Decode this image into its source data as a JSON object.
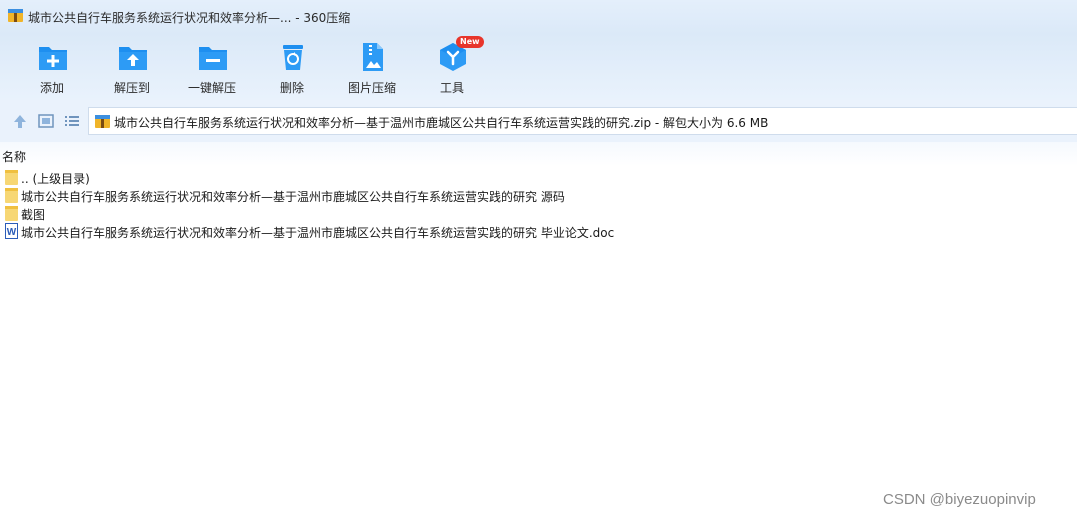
{
  "window": {
    "title": "城市公共自行车服务系统运行状况和效率分析—... - 360压缩"
  },
  "toolbar": {
    "items": [
      {
        "label": "添加",
        "icon": "add-folder-icon"
      },
      {
        "label": "解压到",
        "icon": "extract-to-icon"
      },
      {
        "label": "一键解压",
        "icon": "one-click-extract-icon"
      },
      {
        "label": "删除",
        "icon": "delete-icon"
      },
      {
        "label": "图片压缩",
        "icon": "image-compress-icon"
      },
      {
        "label": "工具",
        "icon": "tools-icon",
        "badge": "New"
      }
    ]
  },
  "nav": {
    "path": "城市公共自行车服务系统运行状况和效率分析—基于温州市鹿城区公共自行车系统运营实践的研究.zip - 解包大小为 6.6 MB"
  },
  "list": {
    "header_name": "名称",
    "rows": [
      {
        "name": ".. (上级目录)",
        "icon": "folder-icon"
      },
      {
        "name": "城市公共自行车服务系统运行状况和效率分析—基于温州市鹿城区公共自行车系统运营实践的研究 源码",
        "icon": "folder-icon"
      },
      {
        "name": "截图",
        "icon": "folder-icon"
      },
      {
        "name": "城市公共自行车服务系统运行状况和效率分析—基于温州市鹿城区公共自行车系统运营实践的研究 毕业论文.doc",
        "icon": "word-doc-icon"
      }
    ]
  },
  "watermark": "CSDN @biyezuopinvip",
  "colors": {
    "accent": "#1e8ff0",
    "titlebar_bg": "#dbe9f8",
    "badge": "#e8352b"
  }
}
